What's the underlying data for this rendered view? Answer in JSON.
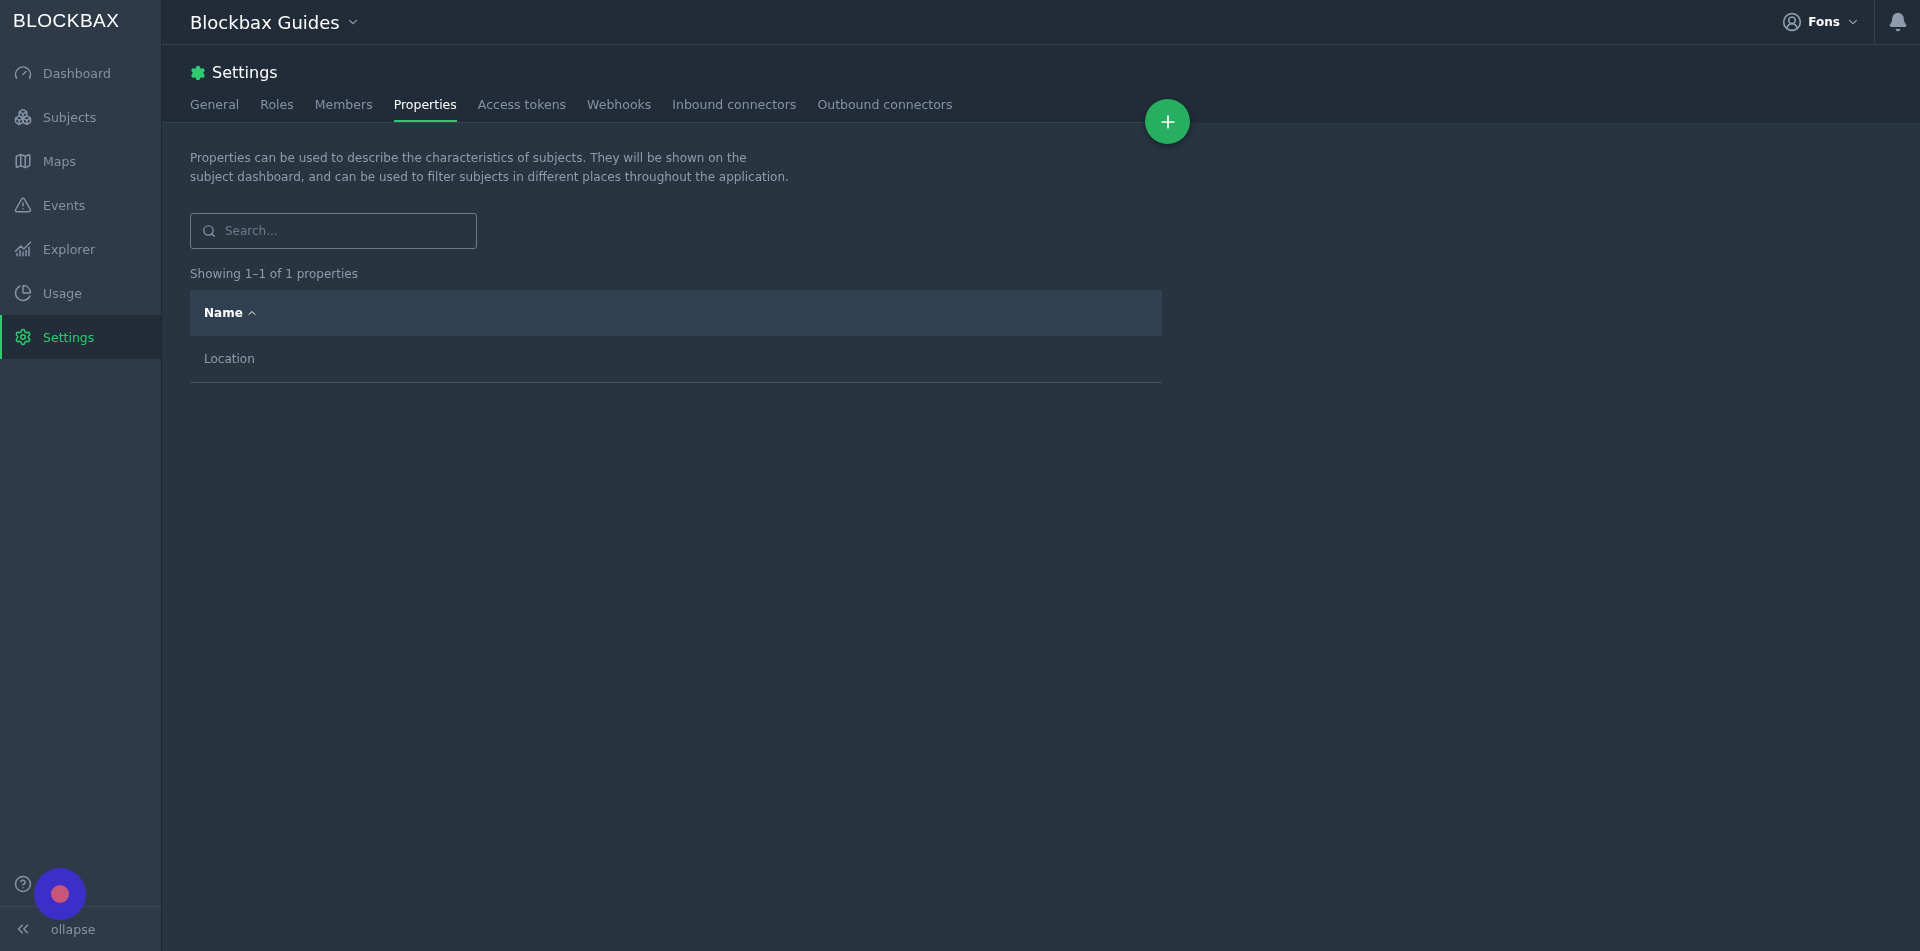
{
  "logo": "BLOCKBAX",
  "sidebar": {
    "items": [
      {
        "kind": "dashboard",
        "label": "Dashboard",
        "selected": false
      },
      {
        "kind": "subjects",
        "label": "Subjects",
        "selected": false
      },
      {
        "kind": "maps",
        "label": "Maps",
        "selected": false
      },
      {
        "kind": "events",
        "label": "Events",
        "selected": false
      },
      {
        "kind": "explorer",
        "label": "Explorer",
        "selected": false
      },
      {
        "kind": "usage",
        "label": "Usage",
        "selected": false
      },
      {
        "kind": "settings",
        "label": "Settings",
        "selected": true
      }
    ],
    "collapse": "ollapse"
  },
  "header": {
    "project": "Blockbax Guides",
    "user": "Fons"
  },
  "page": {
    "title": "Settings",
    "tabs": [
      {
        "label": "General",
        "selected": false
      },
      {
        "label": "Roles",
        "selected": false
      },
      {
        "label": "Members",
        "selected": false
      },
      {
        "label": "Properties",
        "selected": true
      },
      {
        "label": "Access tokens",
        "selected": false
      },
      {
        "label": "Webhooks",
        "selected": false
      },
      {
        "label": "Inbound connectors",
        "selected": false
      },
      {
        "label": "Outbound connectors",
        "selected": false
      }
    ],
    "description": "Properties can be used to describe the characteristics of subjects. They will be shown on the subject dashboard, and can be used to filter subjects in different places throughout the application.",
    "search": {
      "placeholder": "Search..."
    },
    "count": "Showing 1–1 of 1 properties",
    "table": {
      "columns": [
        {
          "label": "Name",
          "sort_ascending": true
        }
      ],
      "rows": [
        [
          "Location"
        ]
      ]
    }
  }
}
